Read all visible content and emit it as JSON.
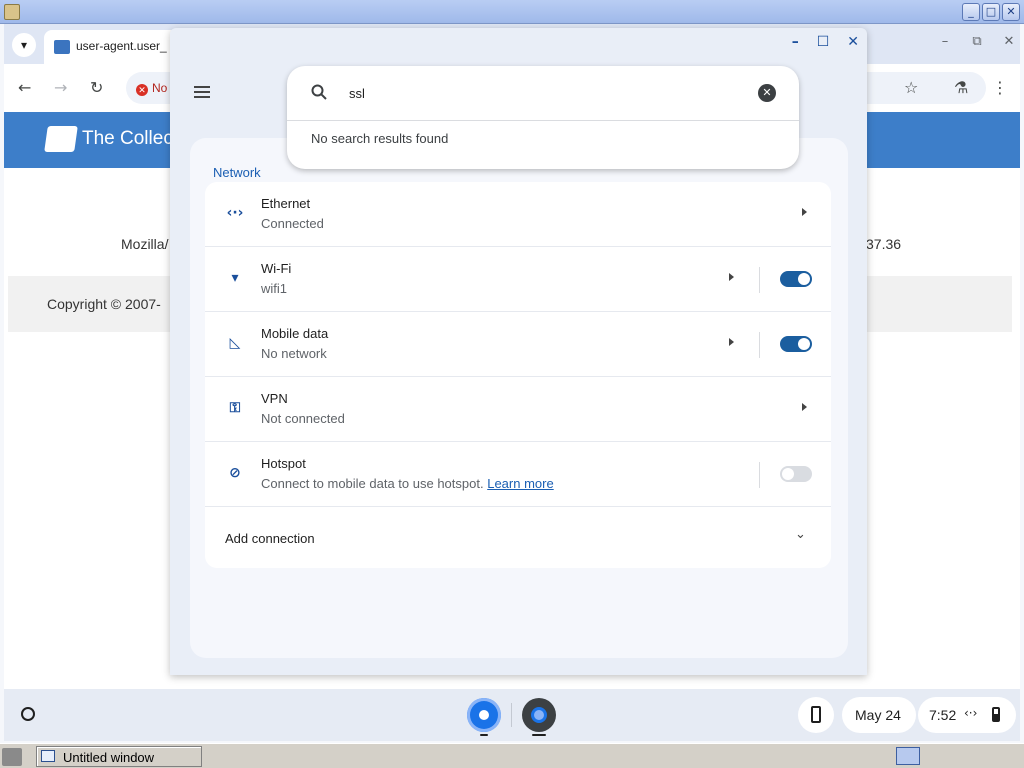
{
  "host": {
    "window_buttons": [
      "_",
      "□",
      "✕"
    ],
    "taskbar_item": "Untitled window"
  },
  "browser": {
    "tab_title": "user-agent.user_",
    "window_ctrls": [
      "–",
      "⧉",
      "✕"
    ],
    "nav": {
      "back": "←",
      "forward": "→",
      "reload": "↻"
    },
    "not_secure_label": "No",
    "toolbar_right_icons": {
      "bookmark": "☆",
      "labs": "⚗",
      "menu": "⋮"
    },
    "site_title": "The Collec",
    "ua_left": "Mozilla/",
    "ua_right": "37.36",
    "footer": "Copyright © 2007-"
  },
  "settings": {
    "window_ctrls": [
      "–",
      "☐",
      "✕"
    ],
    "search": {
      "query": "ssl",
      "no_results": "No search results found"
    },
    "section_label": "Network",
    "rows": [
      {
        "title": "Ethernet",
        "subtitle": "Connected",
        "icon": "ethernet-icon",
        "glyph": "‹·›",
        "has_toggle": false
      },
      {
        "title": "Wi-Fi",
        "subtitle": "wifi1",
        "icon": "wifi-lock-icon",
        "glyph": "▾",
        "has_toggle": true,
        "toggle_on": true
      },
      {
        "title": "Mobile data",
        "subtitle": "No network",
        "icon": "cellular-icon",
        "glyph": "◺",
        "has_toggle": true,
        "toggle_on": true
      },
      {
        "title": "VPN",
        "subtitle": "Not connected",
        "icon": "vpn-key-icon",
        "glyph": "⚿",
        "has_toggle": false
      },
      {
        "title": "Hotspot",
        "subtitle": "Connect to mobile data to use hotspot.",
        "link": "Learn more",
        "icon": "hotspot-off-icon",
        "glyph": "⊘",
        "has_toggle": true,
        "toggle_on": false
      }
    ],
    "add_connection": "Add connection"
  },
  "shelf": {
    "date": "May 24",
    "time": "7:52",
    "net_glyph": "‹·›"
  },
  "colors": {
    "accent": "#1b5e9f",
    "site_header": "#3d7ec9",
    "panel_bg": "#f5f7fc"
  }
}
